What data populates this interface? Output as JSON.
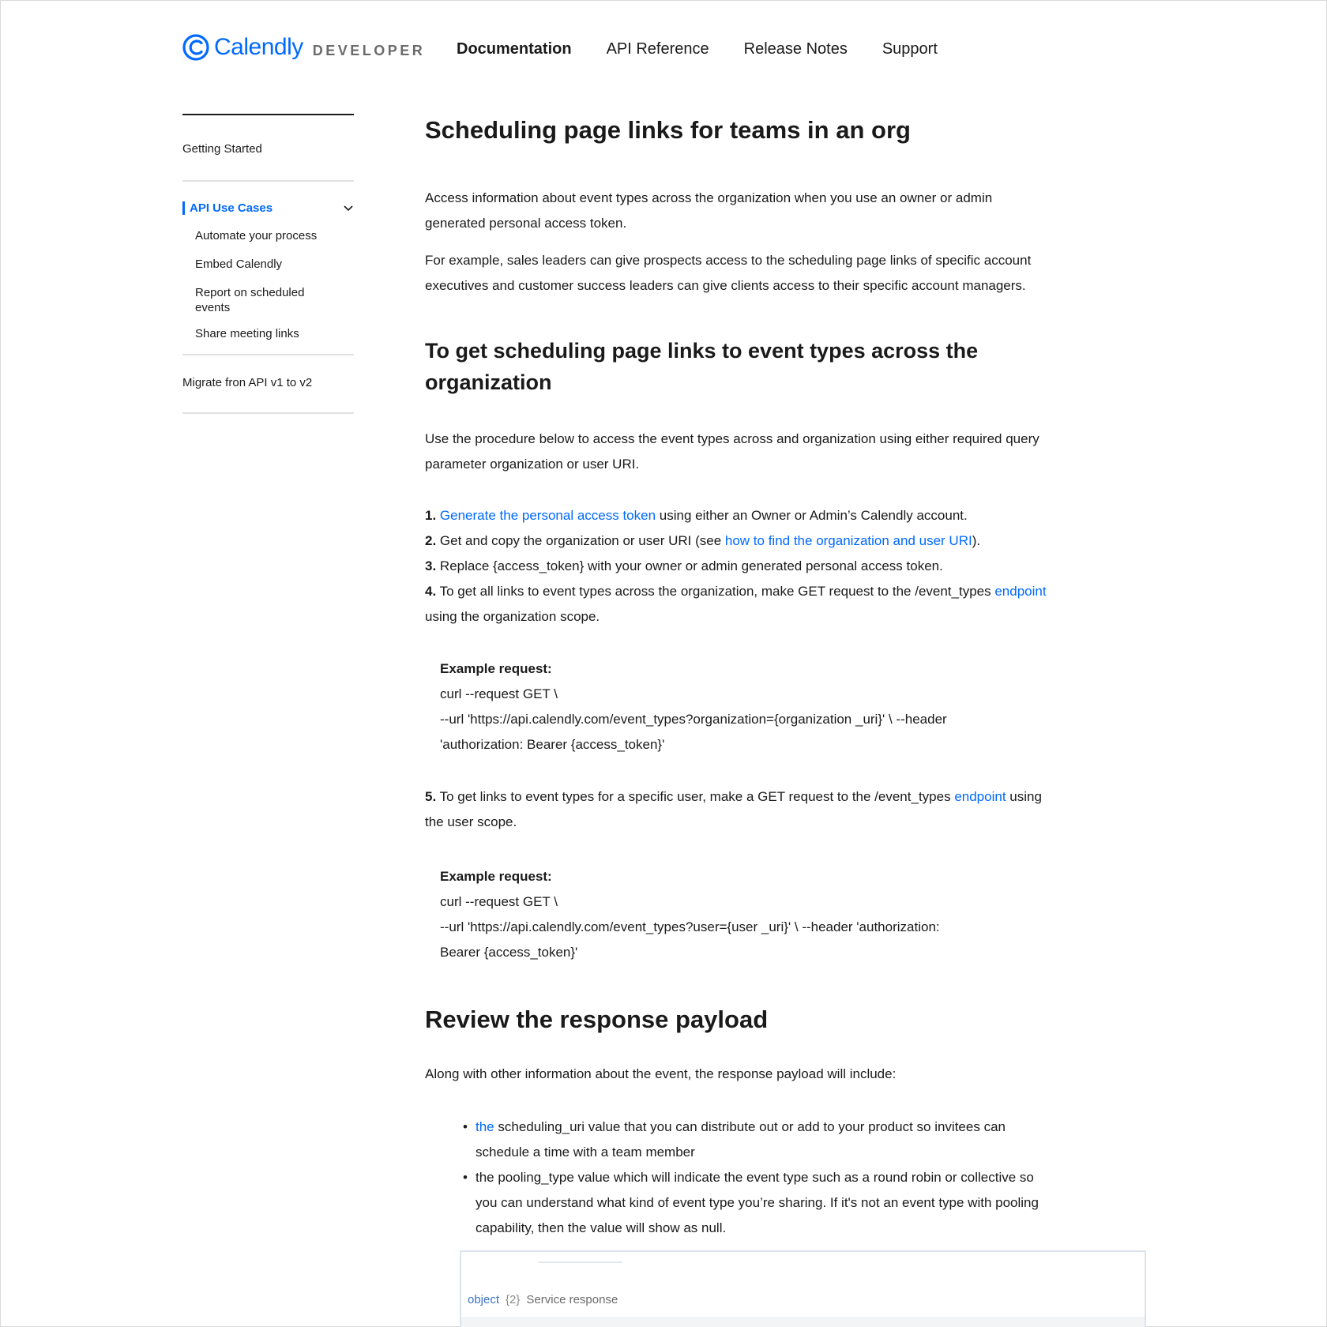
{
  "brand": {
    "name": "Calendly",
    "suffix": "DEVELOPER",
    "color": "#0069ff"
  },
  "topnav": [
    {
      "label": "Documentation",
      "active": true
    },
    {
      "label": "API Reference",
      "active": false
    },
    {
      "label": "Release Notes",
      "active": false
    },
    {
      "label": "Support",
      "active": false
    }
  ],
  "sidebar": {
    "getting_started": "Getting Started",
    "group": {
      "title": "API Use Cases",
      "expanded": true,
      "icon": "chevron-down-icon",
      "items": [
        "Automate your process",
        "Embed Calendly",
        "Report on scheduled events",
        "Share meeting links"
      ]
    },
    "migrate": "Migrate fron API v1 to v2"
  },
  "content": {
    "title": "Scheduling page links for teams in an org",
    "intro1": "Access information about event types across the organization when you use an owner or admin generated personal access token.",
    "intro2": "For example, sales leaders can give prospects access to the scheduling page links of specific account executives and customer success leaders can give clients access to their specific account managers.",
    "h2_procedure": "To get scheduling page links to event types across the organization",
    "procedure_intro": "Use the procedure below to access the event types across and organization using either required query parameter organization or user URI.",
    "steps": {
      "s1_num": "1.",
      "s1_link": "Generate the personal access token",
      "s1_rest": " using either an Owner or Admin’s Calendly account.",
      "s2_num": "2.",
      "s2_pre": " Get and copy the organization or user URI (see ",
      "s2_link": "how to find the organization and user URI",
      "s2_post": ").",
      "s3_num": "3.",
      "s3_text": " Replace {access_token} with your owner or admin generated personal access token.",
      "s4_num": "4.",
      "s4_pre": " To get all links to event types across the organization, make GET request to the /event_types ",
      "s4_link": "endpoint",
      "s4_post": "using the organization scope.",
      "s5_num": "5.",
      "s5_pre": " To get links to event types for a specific user, make a GET request to the /event_types ",
      "s5_link": "endpoint",
      "s5_post_a": " using",
      "s5_post_b": "the user scope."
    },
    "example1": {
      "label": "Example request:",
      "line1": "curl --request GET \\",
      "line2": "--url 'https://api.calendly.com/event_types?organization={organization _uri}' \\  --header",
      "line3": "'authorization: Bearer {access_token}'"
    },
    "example2": {
      "label": "Example request:",
      "line1": "curl --request GET \\",
      "line2": "--url 'https://api.calendly.com/event_types?user={user _uri}' \\  --header 'authorization:",
      "line3": "Bearer {access_token}'"
    },
    "h2_payload": "Review the response payload",
    "payload_intro": "Along with other information about the event, the response payload will include:",
    "bullet1_link": "the",
    "bullet1_text": " scheduling_uri value that you can distribute out or add to your product so invitees can schedule a time with a team member",
    "bullet2_text": "the pooling_type value which will indicate the event type such as a round robin or collective so you can understand what kind of event type you’re sharing. If it's not an event type with pooling capability, then the value will show as null."
  },
  "schema": {
    "type": "object",
    "count": "{2}",
    "description": "Service response"
  }
}
